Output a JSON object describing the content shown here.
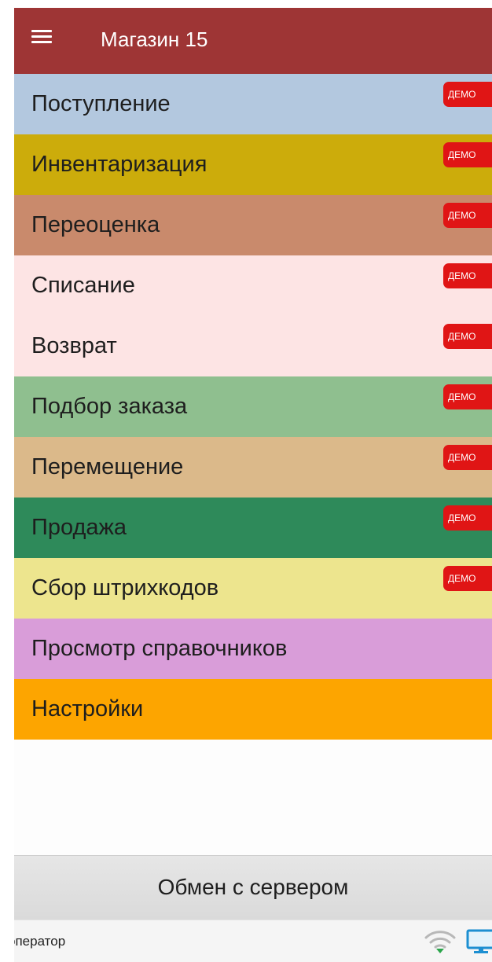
{
  "header": {
    "title": "Магазин 15",
    "menu_icon": "hamburger-menu-icon",
    "background": "#9e3535"
  },
  "menu": {
    "badge_label": "ДЕМО",
    "badge_color": "#e01515",
    "items": [
      {
        "label": "Поступление",
        "color": "#b3c8df",
        "demo": true
      },
      {
        "label": "Инвентаризация",
        "color": "#ccac0b",
        "demo": true
      },
      {
        "label": "Переоценка",
        "color": "#c98a6c",
        "demo": true
      },
      {
        "label": "Списание",
        "color": "#fde4e4",
        "demo": true
      },
      {
        "label": "Возврат",
        "color": "#fde4e4",
        "demo": true
      },
      {
        "label": "Подбор заказа",
        "color": "#8fbf8f",
        "demo": true
      },
      {
        "label": "Перемещение",
        "color": "#dbb98a",
        "demo": true
      },
      {
        "label": "Продажа",
        "color": "#2e8a5a",
        "demo": true
      },
      {
        "label": "Сбор штрихкодов",
        "color": "#ede58e",
        "demo": true
      },
      {
        "label": "Просмотр справочников",
        "color": "#d99dd9",
        "demo": false
      },
      {
        "label": "Настройки",
        "color": "#fda500",
        "demo": false
      }
    ]
  },
  "footer": {
    "exchange_button": "Обмен с сервером",
    "operator_label": "оператор",
    "wifi_icon": "wifi-icon",
    "monitor_icon": "monitor-icon"
  }
}
